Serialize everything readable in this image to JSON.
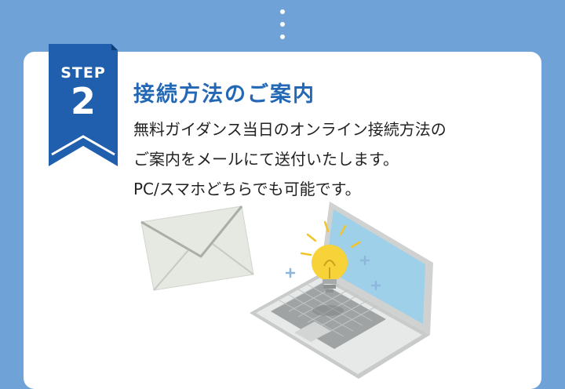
{
  "step": {
    "label": "STEP",
    "number": "2"
  },
  "title": "接続方法のご案内",
  "description": [
    "無料ガイダンス当日のオンライン接続方法の",
    "ご案内をメールにて送付いたします。",
    "PC/スマホどちらでも可能です。"
  ],
  "icons": [
    "envelope-icon",
    "laptop-icon",
    "lightbulb-icon",
    "sparkle-icon"
  ],
  "colors": {
    "background": "#6fa3d8",
    "card": "#ffffff",
    "accent": "#1f5fae",
    "title": "#2468b5",
    "text": "#222222"
  }
}
